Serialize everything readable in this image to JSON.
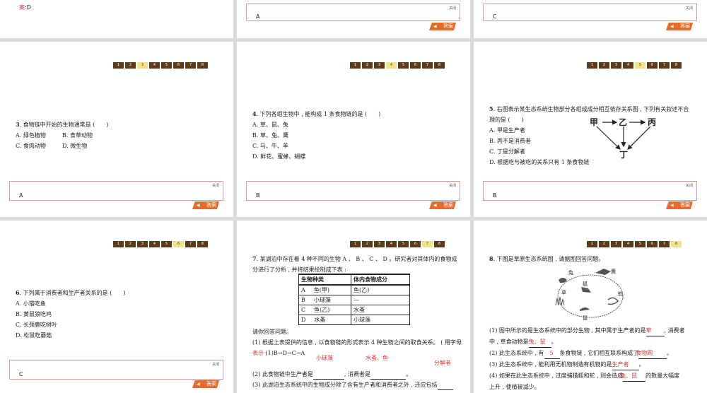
{
  "nav": [
    "1",
    "2",
    "3",
    "4",
    "5",
    "6",
    "7",
    "8"
  ],
  "common": {
    "close_label": "关闭",
    "answer_label": "答案"
  },
  "top": {
    "p1_answer_prefix": "案",
    "p1_answer": ":D",
    "p2_answer": "A",
    "p3_answer": "C"
  },
  "q3": {
    "number": "3",
    "stem": ". 食物链中开始的生物通常是 (　　)",
    "opt_a": "A. 绿色植物",
    "opt_b": "B. 食草动物",
    "opt_c": "C. 食肉动物",
    "opt_d": "D. 微生物",
    "answer": "A"
  },
  "q4": {
    "number": "4",
    "stem": ". 下列各组生物中 , 能构成 1 条食物链的是 (　　)",
    "opt_a": "A. 草、鼠、兔",
    "opt_b": "B. 草、兔、鹰",
    "opt_c": "C. 马、牛、羊",
    "opt_d": "D. 鲜花、蜜蜂、蝴蝶",
    "answer": "B"
  },
  "q5": {
    "number": "5",
    "stem1": ". 右图表示某生态系统生物部分各组成成分相互依存关系图 , 下列有关叙述不合",
    "stem2": "理的是 (　　)",
    "opt_a": "A. 甲是生产者",
    "opt_b": "B. 丙不是消费者",
    "opt_c": "C. 丁是分解者",
    "opt_d": "D. 根据吃与被吃的关系只有 1 条食物链",
    "diagram": {
      "a": "甲",
      "b": "乙",
      "c": "丙",
      "d": "丁"
    },
    "answer": "B"
  },
  "q6": {
    "number": "6",
    "stem": ". 下列属于消费者和生产者关系的是 (　　)",
    "opt_a": "A. 小猫吃鱼",
    "opt_b": "B. 黄鼠狼吃鸡",
    "opt_c": "C. 长颈鹿吃树叶",
    "opt_d": "D. 松鼠吃蘑菇",
    "answer": "C"
  },
  "q7": {
    "number": "7",
    "stem1": ". 某湖泊中存在着 4 种不同的生物 A 、 B 、 C 、 D 。研究者对其体内的食物成",
    "stem2": "分进行了分析 , 并将结果绘制成下表 :",
    "table_headers": [
      "生物种类",
      "体内食物成分"
    ],
    "table_rows": [
      [
        "A",
        "鱼(甲)",
        "鱼(乙)"
      ],
      [
        "B",
        "小球藻",
        "—"
      ],
      [
        "C",
        "鱼(乙)",
        "水蚤"
      ],
      [
        "D",
        "水蚤",
        "小球藻"
      ]
    ],
    "prompt": "请你回答问题。",
    "sub1": "(1) 根据上表提供的信息 , 以食物链的形式表示 4 种生物之间的取食关系。 ( 用字母",
    "sub1_label": "表示",
    "sub1_answer": "(1)B→D→C→A",
    "sub2_prefix": "(2) 此食物链中生产者是",
    "sub2_mid": ", 消费者是",
    "sub2_end": "。",
    "sub2_ans1": "小球藻",
    "sub2_ans2": "水蚤、鱼",
    "sub3": "(3) 此湖泊生态系统中的生物成分除了含有生产者和消费者之外 , 还应包括",
    "sub3_ans": "分解者"
  },
  "q8": {
    "number": "8",
    "stem": ". 下图是草原生态系统图 , 请据图回答问题。",
    "img_labels": {
      "hawk": "鹰",
      "rabbit": "兔",
      "fox": "狐",
      "grass": "草",
      "mouse": "鼠",
      "snake": "蛇"
    },
    "s1_a": "(1) 图中所示的是生态系统中的部分生物 , 其中属于生产者的是",
    "s1_ans1": "草",
    "s1_b": ", 消费者",
    "s1_c": "中 , 草食动物是",
    "s1_ans2": "兔、鼠",
    "s1_d": "。",
    "s2_a": "(2) 此生态系统中 , 有",
    "s2_ans1": "5",
    "s2_b": "条食物链 , 它们相互联系构成了",
    "s2_ans2": "食物网",
    "s2_c": "。",
    "s3_a": "(3) 此生态系统中 , 能利用无机物制造有机物的是",
    "s3_ans": "生产者",
    "s3_b": "。",
    "s4_a": "(4) 如果在此生态系统中 , 过度捕猎狐和蛇 , 则会造成",
    "s4_ans": "兔、鼠",
    "s4_b": "的数量大幅度",
    "s4_c": "上升 , 使植被减少。"
  }
}
